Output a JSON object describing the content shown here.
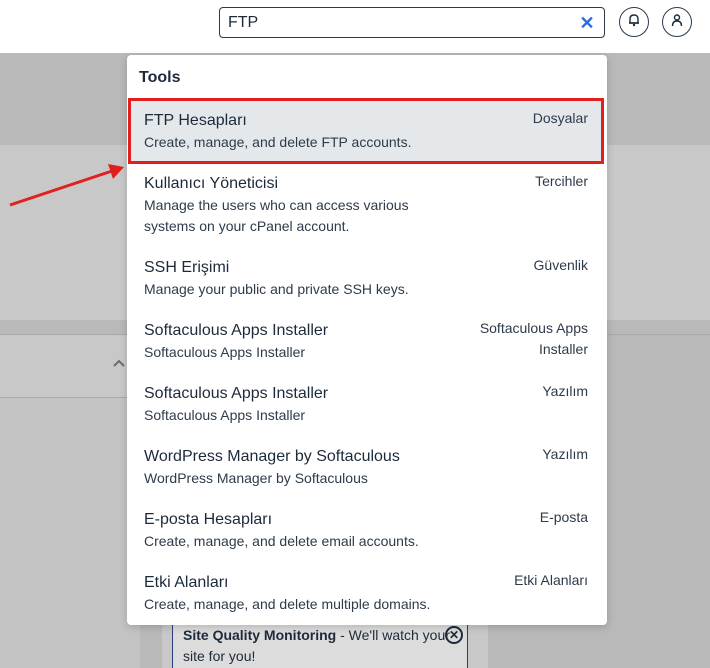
{
  "search": {
    "value": "FTP",
    "clear_symbol": "✕"
  },
  "background": {
    "promo_bold": "Site Quality Monitoring",
    "promo_text": " - We'll watch your site for you!",
    "promo_close": "✕"
  },
  "dropdown": {
    "header": "Tools",
    "results": [
      {
        "title": "FTP Hesapları",
        "desc": "Create, manage, and delete FTP accounts.",
        "category": "Dosyalar"
      },
      {
        "title": "Kullanıcı Yöneticisi",
        "desc": "Manage the users who can access various systems on your cPanel account.",
        "category": "Tercihler"
      },
      {
        "title": "SSH Erişimi",
        "desc": "Manage your public and private SSH keys.",
        "category": "Güvenlik"
      },
      {
        "title": "Softaculous Apps Installer",
        "desc": "Softaculous Apps Installer",
        "category": "Softaculous Apps Installer"
      },
      {
        "title": "Softaculous Apps Installer",
        "desc": "Softaculous Apps Installer",
        "category": "Yazılım"
      },
      {
        "title": "WordPress Manager by Softaculous",
        "desc": "WordPress Manager by Softaculous",
        "category": "Yazılım"
      },
      {
        "title": "E-posta Hesapları",
        "desc": "Create, manage, and delete email accounts.",
        "category": "E-posta"
      },
      {
        "title": "Etki Alanları",
        "desc": "Create, manage, and delete multiple domains.",
        "category": "Etki Alanları"
      }
    ]
  },
  "colors": {
    "highlight_border": "#e0201e",
    "selected_bg": "#e4e8eb",
    "clear_icon": "#2d6cdf"
  }
}
